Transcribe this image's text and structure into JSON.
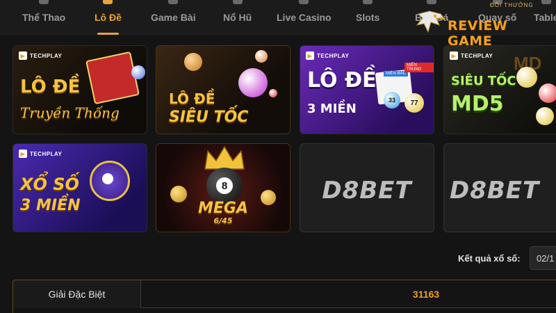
{
  "nav": {
    "items": [
      {
        "label": "Thể Thao"
      },
      {
        "label": "Lô Đề"
      },
      {
        "label": "Game Bài"
      },
      {
        "label": "Nổ Hũ"
      },
      {
        "label": "Live Casino"
      },
      {
        "label": "Slots"
      },
      {
        "label": "Bắn Cá"
      },
      {
        "label": "Quay số"
      },
      {
        "label": "Table"
      }
    ],
    "active_color": "#e8a33a"
  },
  "logo": {
    "small_text": "ĐỐI THƯỞNG",
    "main_text": "REVIEW GAME"
  },
  "cards": [
    {
      "brand": "TECHPLAY",
      "line1": "LÔ ĐỀ",
      "line2": "Truyền Thống"
    },
    {
      "line1": "LÔ ĐỀ",
      "line2": "SIÊU TỐC"
    },
    {
      "brand": "TECHPLAY",
      "line1": "LÔ ĐỀ",
      "line2": "3 MIỀN",
      "badge1": "MIỀN BẮC",
      "badge2": "MIỀN TRUNG",
      "balls": [
        "33",
        "77"
      ]
    },
    {
      "brand": "TECHPLAY",
      "line1": "SIÊU TỐC",
      "line2": "MD5",
      "partial": "MD"
    },
    {
      "brand": "TECHPLAY",
      "line1": "XỔ SỐ",
      "line2": "3 MIỀN"
    },
    {
      "line1": "MEGA",
      "line2": "6/45",
      "ball": "8"
    },
    {
      "logo": "D8BET"
    },
    {
      "logo": "D8BET"
    }
  ],
  "results": {
    "label": "Kết quả xổ số:",
    "date": "02/1",
    "rows": [
      {
        "label": "Giải Đặc Biệt",
        "value": "31163"
      }
    ]
  }
}
